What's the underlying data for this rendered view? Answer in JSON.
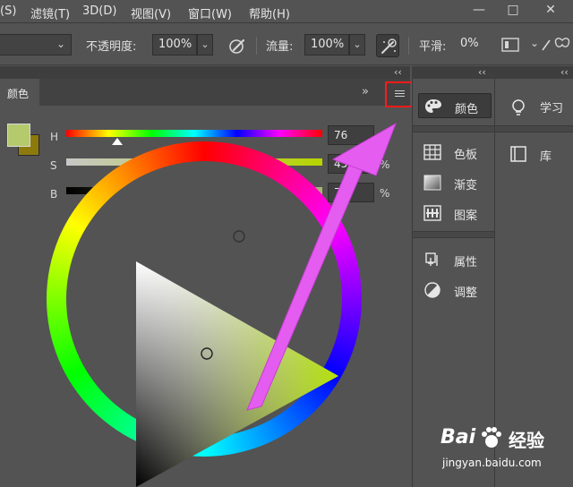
{
  "menubar": {
    "items": [
      "(S)",
      "滤镜(T)",
      "3D(D)",
      "视图(V)",
      "窗口(W)",
      "帮助(H)"
    ]
  },
  "window_controls": {
    "minimize": "—",
    "restore": "□",
    "close": "✕"
  },
  "options_bar": {
    "opacity_label": "不透明度:",
    "opacity_value": "100%",
    "flow_label": "流量:",
    "flow_value": "100%",
    "smooth_label": "平滑:",
    "smooth_value": "0%"
  },
  "collapse": {
    "left": "‹‹",
    "mid": "‹‹",
    "right": "‹‹"
  },
  "color_panel": {
    "tab_label": "颜色",
    "expand_glyph": "»",
    "sliders": [
      {
        "label": "H",
        "value": "76",
        "unit": "",
        "position": 0.2
      },
      {
        "label": "S",
        "value": "45",
        "unit": "%",
        "position": 0.45
      },
      {
        "label": "B",
        "value": "78",
        "unit": "%",
        "position": 0.765
      }
    ]
  },
  "dock_mid": {
    "items": [
      {
        "label": "颜色",
        "icon": "palette-icon",
        "active": true
      },
      {
        "label": "色板",
        "icon": "swatches-grid-icon",
        "active": false
      },
      {
        "label": "渐变",
        "icon": "gradient-icon",
        "active": false
      },
      {
        "label": "图案",
        "icon": "pattern-icon",
        "active": false
      },
      {
        "label": "属性",
        "icon": "properties-icon",
        "active": false
      },
      {
        "label": "调整",
        "icon": "adjustments-icon",
        "active": false
      }
    ]
  },
  "dock_right": {
    "items": [
      {
        "label": "学习",
        "icon": "lightbulb-icon"
      },
      {
        "label": "库",
        "icon": "library-icon"
      }
    ]
  },
  "watermark": {
    "brand_a": "Bai",
    "brand_b": "经验",
    "url": "jingyan.baidu.com"
  },
  "colors": {
    "annotation_box": "#ff1a1a",
    "arrow": "#e55cf0",
    "foreground_swatch": "#b5c96d",
    "background_swatch": "#8d7a0d"
  }
}
